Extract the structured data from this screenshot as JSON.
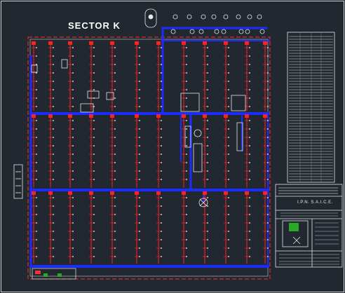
{
  "drawing": {
    "title": "SECTOR K",
    "title_block_text": "I.P.N. S.A.I.C.E."
  },
  "colors": {
    "background": "#212830",
    "boundary": "#e0e0e0",
    "main_pipe": "#1a2cff",
    "branch_line": "#ff2020",
    "sprinkler": "#ffffff",
    "equipment": "#e8e8e8",
    "legend_green": "#2aa82a"
  }
}
